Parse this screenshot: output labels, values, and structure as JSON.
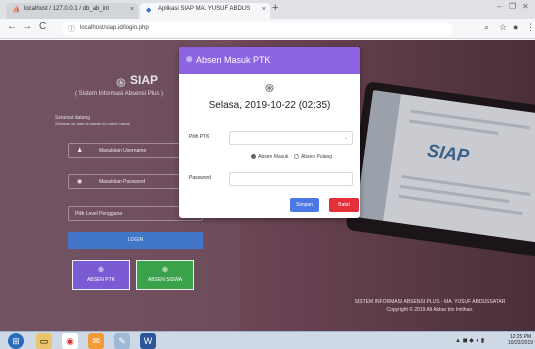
{
  "browser": {
    "tabs": [
      {
        "label": "localhost / 127.0.0.1 / db_ab_int"
      },
      {
        "label": "Aplikasi SIAP MA. YUSUF ABDUS"
      }
    ],
    "new_tab": "+",
    "nav": {
      "back": "←",
      "forward": "→",
      "reload": "C"
    },
    "url": "localhost/siap.id/login.php"
  },
  "siap": {
    "title": "SIAP",
    "subtitle": "( Sistem Informasi Absensi Plus )",
    "welcome": "Selamat datang",
    "instruction": "Silahkan isi data di bawah ini untuk masuk",
    "username_placeholder": "Masukkan Username",
    "password_placeholder": "Masukkan Password",
    "level_placeholder": "Pilih Level Pengguna",
    "login_label": "LOGIN",
    "absen_ptk_label": "ABSEN PTK",
    "absen_siswa_label": "ABSEN SISWA"
  },
  "modal": {
    "title": "Absen Masuk PTK",
    "datetime": "Selasa, 2019-10-22 (02:35)",
    "pilih_ptk_label": "Pilih PTK",
    "radio_masuk": "Absen Masuk",
    "radio_pulang": "Absen Pulang",
    "password_label": "Password",
    "save_label": "Simpan",
    "cancel_label": "Batal"
  },
  "footer": {
    "line1": "SISTEM INFORMASI ABSENSI PLUS - MA. YUSUF ABDUSSATAR",
    "line2": "Copyright © 2019 Ali Akbar bin Imtihan."
  },
  "laptop_logo": "SIAP",
  "taskbar": {
    "clock_time": "12:25 PM",
    "clock_date": "10/22/2019"
  },
  "colors": {
    "modal_header": "#8c63e0",
    "save": "#4b78e6",
    "cancel": "#e5303a",
    "login": "#4176c9",
    "absen_ptk": "#7a5bd4",
    "absen_siswa": "#3aa24a"
  }
}
